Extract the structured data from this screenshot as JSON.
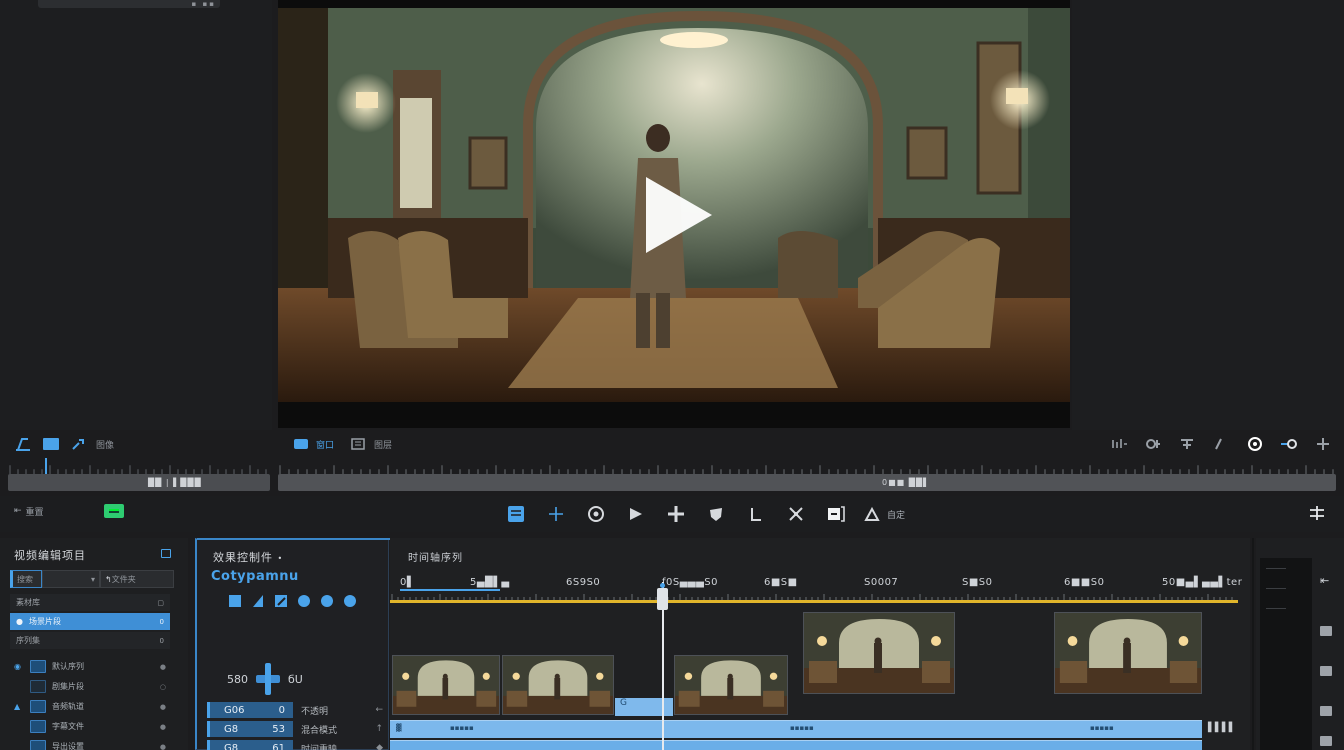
{
  "viewer": {
    "play_label": "Play"
  },
  "source_toolbar": {
    "label": "图像"
  },
  "viewer_toolbar": {
    "view1": "窗口",
    "view2": "图层"
  },
  "source_scrub": {
    "time": "██ | ▌███"
  },
  "viewer_scrub": {
    "time": "0■■ ██▌"
  },
  "edit_bar": {
    "left_label": "重置",
    "right_label": "自定"
  },
  "project": {
    "title": "视频编辑项目",
    "search_tab1": "搜索",
    "search_tab2": "文件夹",
    "rows": [
      {
        "label": "素材库",
        "end": "▢"
      },
      {
        "label": "场景片段",
        "end": "0"
      },
      {
        "label": "序列集",
        "end": "0"
      }
    ],
    "clips": [
      {
        "label": "默认序列",
        "end": "●"
      },
      {
        "label": "剧集片段",
        "end": "○"
      },
      {
        "label": "音频轨道",
        "end": "●"
      },
      {
        "label": "字幕文件",
        "end": "●"
      },
      {
        "label": "导出设置",
        "end": "●"
      }
    ]
  },
  "effects": {
    "title": "效果控制件",
    "subtitle": "Cotypamnu",
    "timecode_left": "580",
    "timecode_right": "бU",
    "rows": [
      {
        "field": "G06",
        "value": "0",
        "name": "不透明",
        "kf": "←"
      },
      {
        "field": "G8",
        "value": "53",
        "name": "混合模式",
        "kf": "↑"
      },
      {
        "field": "G8",
        "value": "61",
        "name": "时间重映",
        "kf": "◆"
      }
    ]
  },
  "timeline": {
    "title": "时间轴序列",
    "timecodes": [
      "0▌",
      "5▄█▌▄",
      "6S9S0",
      "f0S▄▄▄S0",
      "6■S■",
      "S0007",
      "S■S0",
      "6■■S0",
      "50■▄▌▄▄▌ter"
    ],
    "small_clip": "G",
    "bar_end_time": "▌▌▌▌",
    "bar_start": "▓"
  }
}
